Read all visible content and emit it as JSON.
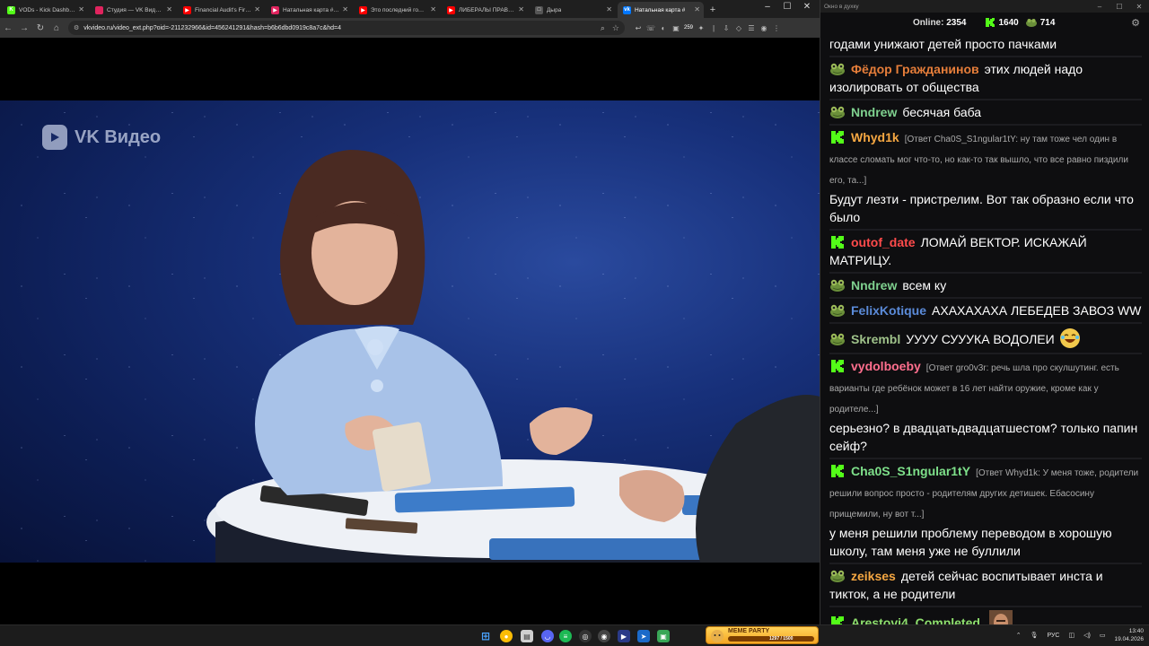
{
  "browser": {
    "tabs": [
      {
        "title": "VODs - Kick Dashboard",
        "icon": "kick-icon",
        "color": "#53fc18",
        "letter": "K"
      },
      {
        "title": "Студия — VK Видео Live",
        "icon": "vk-studio-icon",
        "color": "#e0245e",
        "letter": ""
      },
      {
        "title": "Financial Audit's First F",
        "icon": "youtube-icon",
        "color": "#ff0000",
        "letter": "▶"
      },
      {
        "title": "Натальная карта #58 Л",
        "icon": "vk-video-icon",
        "color": "#e0245e",
        "letter": "▶"
      },
      {
        "title": "Это последний год Пу",
        "icon": "youtube-icon",
        "color": "#ff0000",
        "letter": "▶"
      },
      {
        "title": "ЛИБЕРАЛЫ ПРАВЫ ВС",
        "icon": "youtube-icon",
        "color": "#ff0000",
        "letter": "▶"
      },
      {
        "title": "Дыра",
        "icon": "page-icon",
        "color": "#555555",
        "letter": "□"
      },
      {
        "title": "Натальная карта #",
        "icon": "vk-icon",
        "color": "#0077ff",
        "letter": "vk",
        "active": true
      }
    ],
    "url": "vkvideo.ru/video_ext.php?oid=-211232966&id=456241291&hash=b6b6dbd0919c8a7c&hd=4",
    "ext_badge": "259"
  },
  "video": {
    "logo_text": "VK Видео"
  },
  "chat": {
    "window_title": "Окно в духку",
    "online_label": "Online:",
    "online_count": "2354",
    "kick_count": "1640",
    "frog_count": "714",
    "messages": [
      {
        "user": "",
        "text": "годами унижают детей просто пачками",
        "badge": "none",
        "color": "#ffffff",
        "reply": ""
      },
      {
        "user": "Фёдор Гражданинов",
        "text": "этих людей надо изолировать от  общества",
        "badge": "frog",
        "color": "#e67e3a",
        "reply": ""
      },
      {
        "user": "Nndrew",
        "text": "бесячая баба",
        "badge": "frog",
        "color": "#7fd18f",
        "reply": ""
      },
      {
        "user": "Whyd1k",
        "reply": "[Ответ Cha0S_S1ngular1tY: ну там тоже чел один в классе сломать мог что-то, но как-то так вышло, что все равно пиздили его, та...]",
        "text": "Будут лезти - пристрелим. Вот так образно если что было",
        "badge": "kick",
        "color": "#f5a742"
      },
      {
        "user": "outof_date",
        "text": "ЛОМАЙ ВЕКТОР. ИСКАЖАЙ МАТРИЦУ.",
        "badge": "kick",
        "color": "#ff4b4b",
        "reply": ""
      },
      {
        "user": "Nndrew",
        "text": "всем ку",
        "badge": "frog",
        "color": "#7fd18f",
        "reply": ""
      },
      {
        "user": "FelixKotique",
        "text": "АХАХАХАХА ЛЕБЕДЕВ ЗАВОЗ WW",
        "badge": "frog",
        "color": "#5b8bd9",
        "reply": ""
      },
      {
        "user": "Skrembl",
        "text": "УУУУ СУУУКА ВОДОЛЕИ",
        "badge": "frog",
        "color": "#9fc28a",
        "reply": "",
        "emote": "laughing-emote"
      },
      {
        "user": "vydolboeby",
        "reply": "[Ответ gro0v3r: речь шла про скулшутинг. есть варианты где ребёнок может в 16 лет найти оружие, кроме как у родителе...]",
        "text": "серьезно? в двадцатьдвадцатшестом? только папин сейф?",
        "badge": "kick",
        "color": "#ff6f8e"
      },
      {
        "user": "Cha0S_S1ngular1tY",
        "reply": "[Ответ Whyd1k: У меня тоже, родители решили вопрос просто - родителям других детишек. Ебасосину прищемили, ну вот т...]",
        "text": "у меня решили проблему переводом в хорошую школу, там меня уже не буллили",
        "badge": "kick",
        "color": "#7ee08a"
      },
      {
        "user": "zeikses",
        "text": "детей сейчас воспитывает инста и тикток, а не родители",
        "badge": "frog",
        "color": "#f5a742",
        "reply": ""
      },
      {
        "user": "Arestovi4_Completed",
        "text": "",
        "badge": "kick",
        "color": "#8fe06e",
        "reply": "",
        "emote": "face-emote"
      }
    ]
  },
  "taskbar": {
    "meme_title": "MEME PARTY",
    "meme_progress": "1297 / 1500",
    "lang": "РУС",
    "time": "13:40",
    "date": "19.04.2026"
  }
}
